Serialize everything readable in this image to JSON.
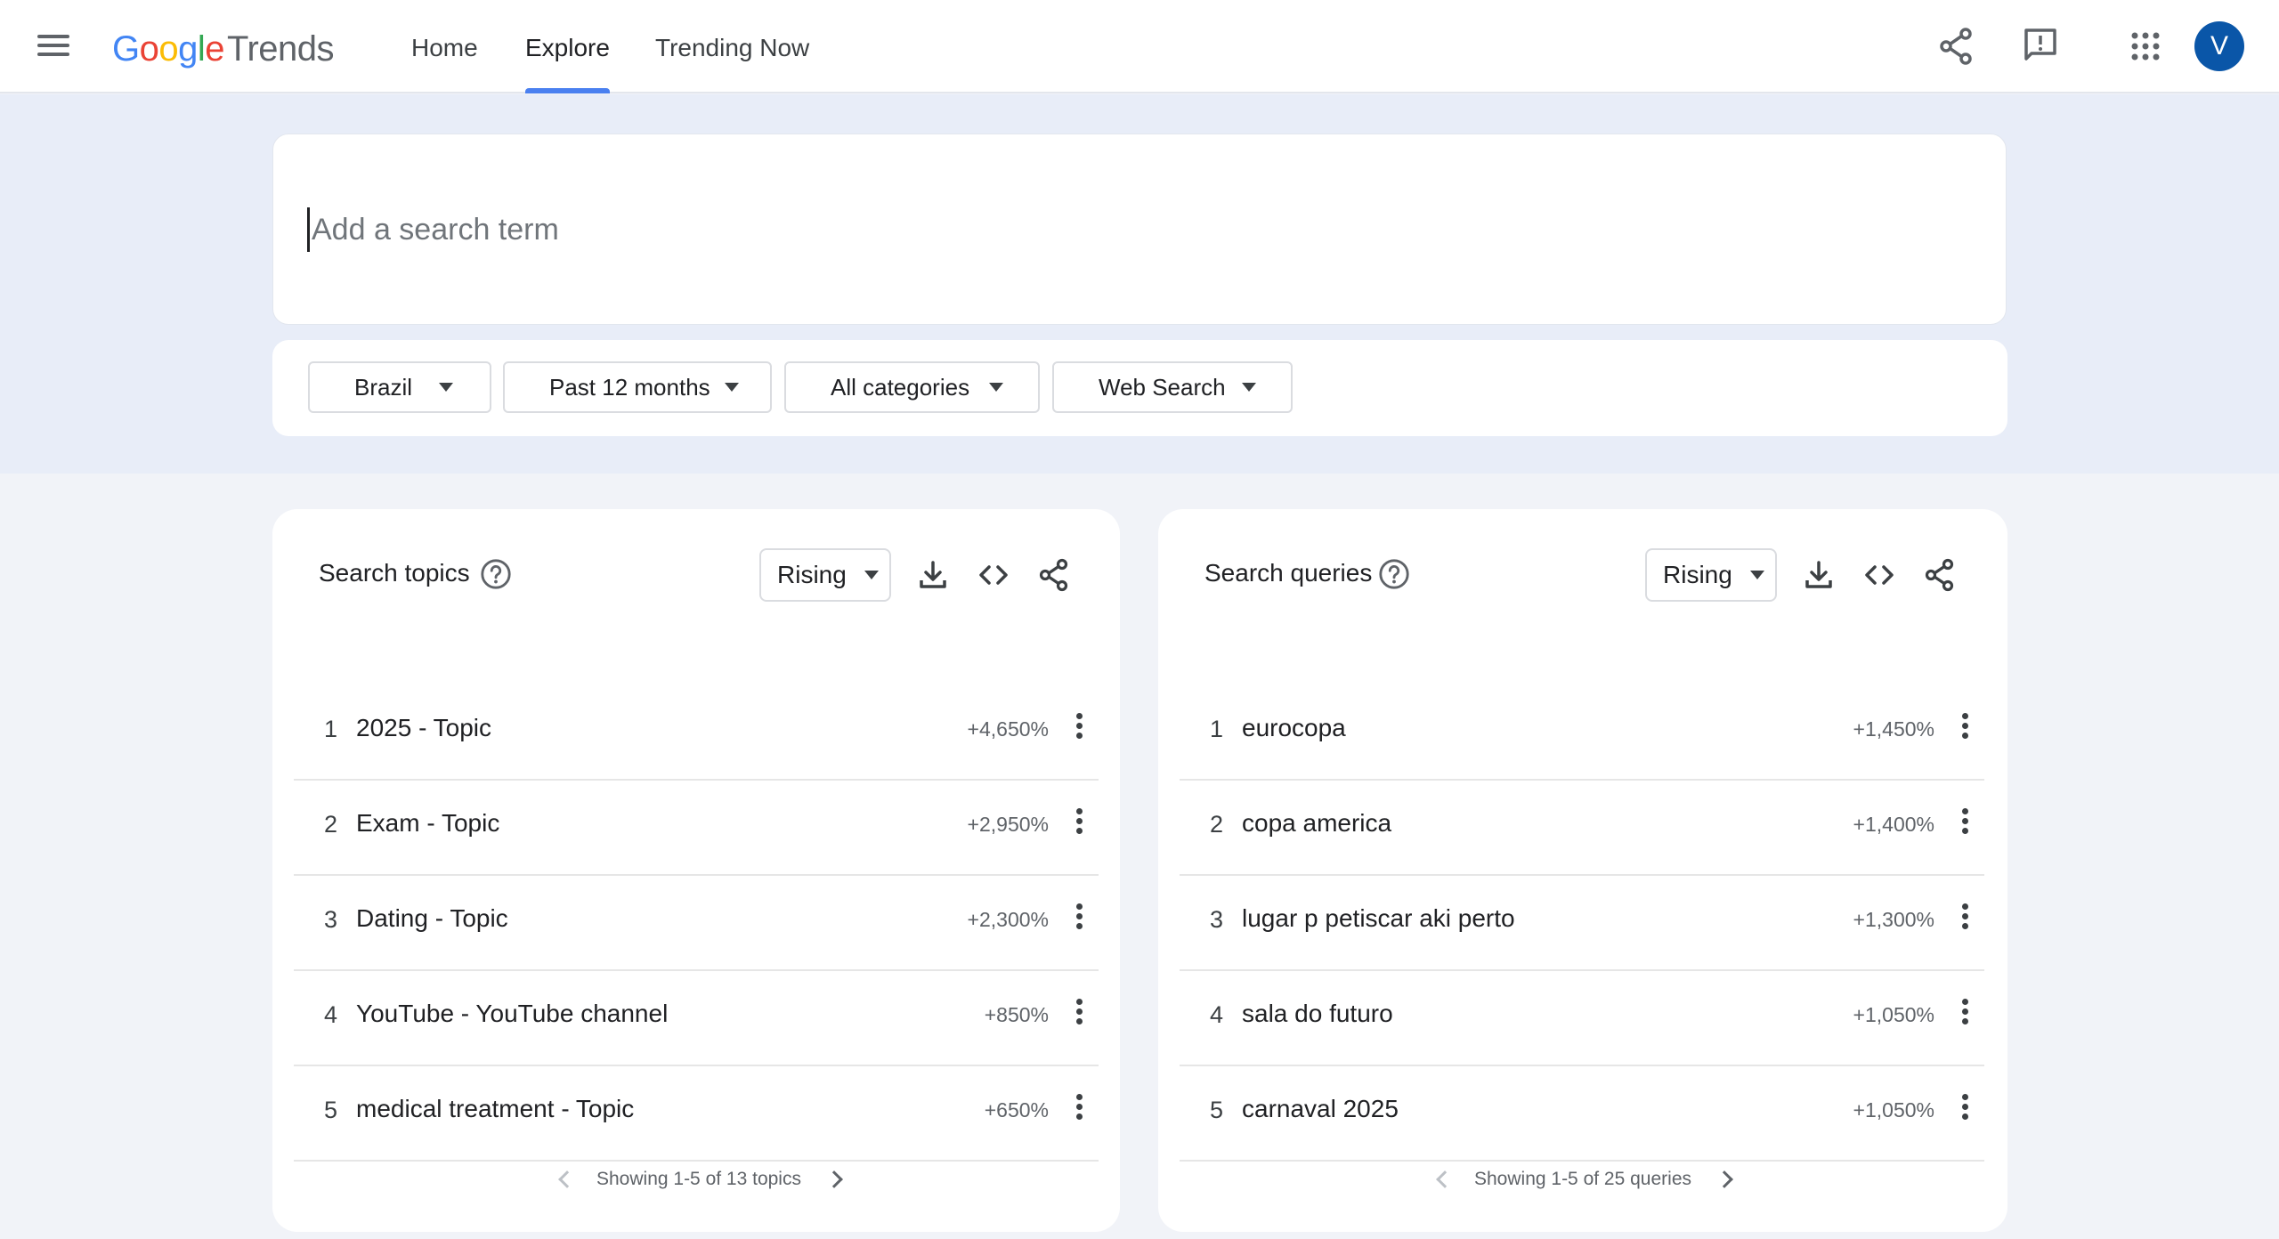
{
  "header": {
    "logo_google": "Google",
    "logo_trends": "Trends",
    "nav": [
      {
        "label": "Home",
        "active": false
      },
      {
        "label": "Explore",
        "active": true
      },
      {
        "label": "Trending Now",
        "active": false
      }
    ],
    "icons": [
      "menu-icon",
      "share-icon",
      "feedback-icon",
      "apps-grid-icon"
    ],
    "avatar_letter": "V",
    "accent_color": "#4a80f0",
    "avatar_color": "#0a56a8"
  },
  "search": {
    "placeholder": "Add a search term",
    "value": ""
  },
  "filters": {
    "location": "Brazil",
    "time_range": "Past 12 months",
    "category": "All categories",
    "search_type": "Web Search"
  },
  "topics_panel": {
    "title": "Search topics",
    "mode": "Rising",
    "rows": [
      {
        "index": "1",
        "term": "2025 - Topic",
        "change": "+4,650%"
      },
      {
        "index": "2",
        "term": "Exam - Topic",
        "change": "+2,950%"
      },
      {
        "index": "3",
        "term": "Dating - Topic",
        "change": "+2,300%"
      },
      {
        "index": "4",
        "term": "YouTube - YouTube channel",
        "change": "+850%"
      },
      {
        "index": "5",
        "term": "medical treatment - Topic",
        "change": "+650%"
      }
    ],
    "pager": "Showing 1-5 of 13 topics"
  },
  "queries_panel": {
    "title": "Search queries",
    "mode": "Rising",
    "rows": [
      {
        "index": "1",
        "term": "eurocopa",
        "change": "+1,450%"
      },
      {
        "index": "2",
        "term": "copa america",
        "change": "+1,400%"
      },
      {
        "index": "3",
        "term": "lugar p petiscar aki perto",
        "change": "+1,300%"
      },
      {
        "index": "4",
        "term": "sala do futuro",
        "change": "+1,050%"
      },
      {
        "index": "5",
        "term": "carnaval 2025",
        "change": "+1,050%"
      }
    ],
    "pager": "Showing 1-5 of 25 queries"
  }
}
